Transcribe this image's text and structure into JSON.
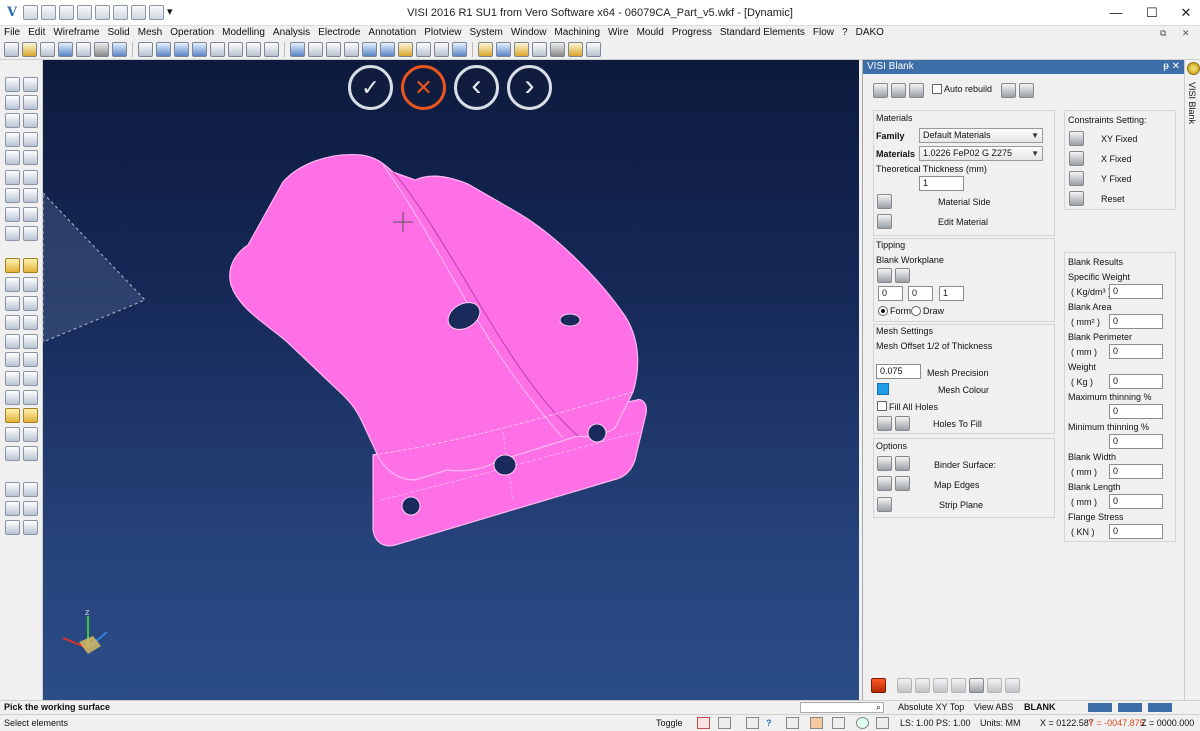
{
  "window": {
    "title": "VISI 2016 R1 SU1 from Vero Software x64 - 06079CA_Part_v5.wkf - [Dynamic]",
    "minimize": "—",
    "maximize": "☐",
    "close": "✕",
    "mdi_restore": "⧉",
    "mdi_close": "✕",
    "logo": "V"
  },
  "menu": [
    "File",
    "Edit",
    "Wireframe",
    "Solid",
    "Mesh",
    "Operation",
    "Modelling",
    "Analysis",
    "Electrode",
    "Annotation",
    "Plotview",
    "System",
    "Window",
    "Machining",
    "Wire",
    "Mould",
    "Progress",
    "Standard Elements",
    "Flow",
    "?",
    "DAKO"
  ],
  "viewport": {
    "ok_icon": "✓",
    "cancel_icon": "✕",
    "prev_icon": "‹",
    "next_icon": "›",
    "axis_z": "z",
    "part_color": "#ff6fe6"
  },
  "panel": {
    "title": "VISI Blank",
    "pin": "ᵽ ✕",
    "auto_rebuild": "Auto rebuild",
    "side_tab": "VISI Blank",
    "materials": {
      "group": "Materials",
      "family_label": "Family",
      "family_value": "Default Materials",
      "materials_label": "Materials",
      "materials_value": "1.0226 FeP02 G Z275",
      "thickness_label": "Theoretical Thickness (mm)",
      "thickness_value": "1",
      "material_side": "Material Side",
      "edit_material": "Edit Material"
    },
    "tipping": {
      "group": "Tipping",
      "blank_workplane": "Blank Workplane",
      "x": "0",
      "y": "0",
      "z": "1",
      "form": "Form",
      "draw": "Draw"
    },
    "mesh": {
      "group": "Mesh Settings",
      "offset": "Mesh Offset 1/2 of Thickness",
      "precision_value": "0.075",
      "precision_label": "Mesh Precision",
      "colour_label": "Mesh Colour",
      "colour": "#1e9ee6",
      "fill_all_holes": "Fill All Holes",
      "holes_to_fill": "Holes To Fill"
    },
    "options": {
      "group": "Options",
      "binder_surface": "Binder Surface:",
      "map_edges": "Map Edges",
      "strip_plane": "Strip Plane"
    },
    "constraints": {
      "group": "Constraints Setting:",
      "xy_fixed": "XY Fixed",
      "x_fixed": "X Fixed",
      "y_fixed": "Y Fixed",
      "reset": "Reset"
    },
    "results": {
      "group": "Blank Results",
      "items": [
        {
          "label": "Specific Weight",
          "unit": "( Kg/dm³ )",
          "value": "0"
        },
        {
          "label": "Blank Area",
          "unit": "( mm² )",
          "value": "0"
        },
        {
          "label": "Blank Perimeter",
          "unit": "( mm )",
          "value": "0"
        },
        {
          "label": "Weight",
          "unit": "( Kg )",
          "value": "0"
        },
        {
          "label": "Maximum thinning %",
          "unit": "",
          "value": "0"
        },
        {
          "label": "Minimum thinning %",
          "unit": "",
          "value": "0"
        },
        {
          "label": "Blank Width",
          "unit": "( mm )",
          "value": "0"
        },
        {
          "label": "Blank Length",
          "unit": "( mm )",
          "value": "0"
        },
        {
          "label": "Flange Stress",
          "unit": "( KN )",
          "value": "0"
        }
      ]
    }
  },
  "prompt": {
    "message": "Pick the working surface",
    "plane": "Absolute XY Top",
    "view": "View ABS",
    "mode": "BLANK"
  },
  "status": {
    "left": "Select elements",
    "toggle": "Toggle",
    "ls": "LS: 1.00 PS: 1.00",
    "units": "Units: MM",
    "x": "X = 0122.587",
    "y": "Y = -0047.875",
    "z": "Z = 0000.000"
  }
}
